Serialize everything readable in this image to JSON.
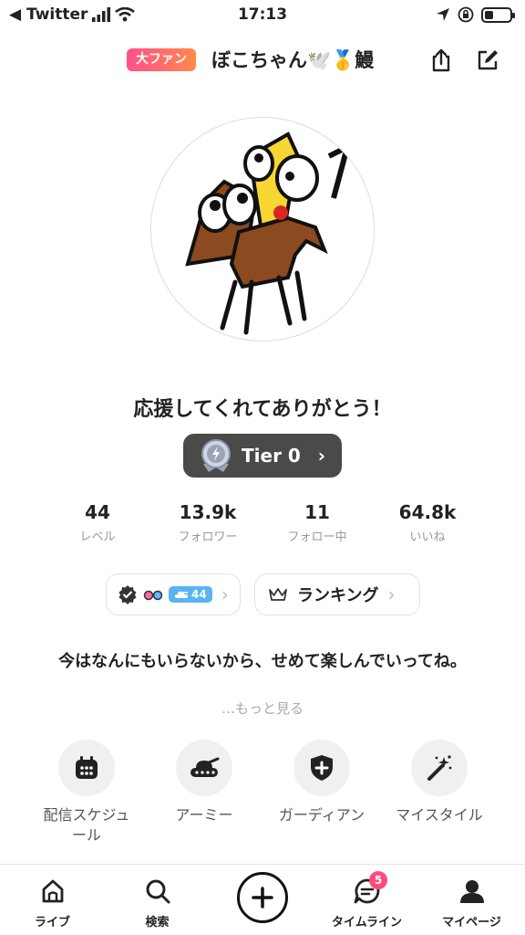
{
  "status_bar": {
    "back_app": "◀ Twitter",
    "time": "17:13",
    "battery_level": 0.35
  },
  "header": {
    "fan_badge": "大ファン",
    "username": "ぼこちゃん🕊️🥇鰻"
  },
  "profile": {
    "tagline": "応援してくれてありがとう！",
    "tier_label": "Tier 0"
  },
  "stats": [
    {
      "value": "44",
      "label": "レベル"
    },
    {
      "value": "13.9k",
      "label": "フォロワー"
    },
    {
      "value": "11",
      "label": "フォロー中"
    },
    {
      "value": "64.8k",
      "label": "いいね"
    }
  ],
  "badges": {
    "level_chip": "44",
    "ranking_label": "ランキング"
  },
  "bio": {
    "text": "今はなんにもいらないから、せめて楽しんでいってね。",
    "more": "…もっと見る"
  },
  "actions": [
    {
      "label": "配信スケジュール"
    },
    {
      "label": "アーミー"
    },
    {
      "label": "ガーディアン"
    },
    {
      "label": "マイスタイル"
    }
  ],
  "tabbar": {
    "live": "ライブ",
    "search": "検索",
    "timeline": "タイムライン",
    "timeline_badge": "5",
    "mypage": "マイページ"
  }
}
